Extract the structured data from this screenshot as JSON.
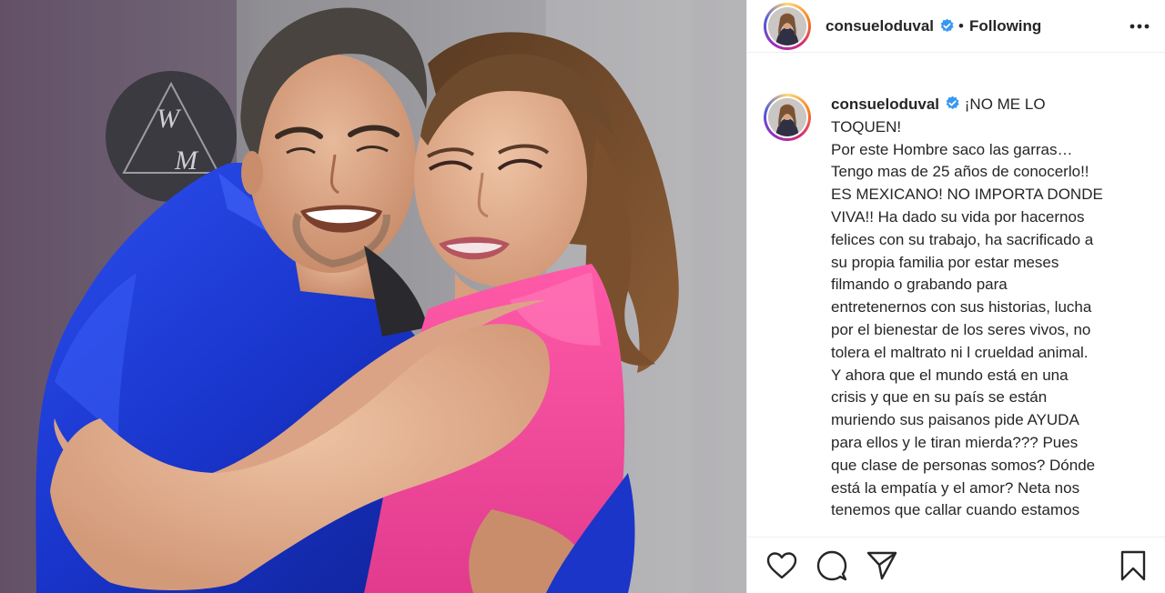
{
  "post": {
    "account": {
      "username": "consueloduval",
      "verified": true,
      "follow_status": "Following",
      "separator": "•"
    },
    "caption": {
      "username": "consueloduval",
      "lines": [
        "¡NO ME LO",
        "TOQUEN!",
        "Por este Hombre saco las garras…",
        "Tengo mas de 25 años de conocerlo!!",
        "ES MEXICANO! NO IMPORTA DONDE",
        "VIVA!! Ha dado su vida por hacernos",
        "felices con su trabajo, ha sacrificado a",
        "su propia familia por estar meses",
        "filmando o grabando para",
        "entretenernos con sus historias, lucha",
        "por el bienestar de los seres vivos, no",
        "tolera el maltrato ni l crueldad animal.",
        "Y ahora que el mundo está en una",
        "crisis y que en su país se están",
        "muriendo sus paisanos pide AYUDA",
        "para ellos y le tiran mierda??? Pues",
        "que clase de personas somos? Dónde",
        "está la empatía y el amor? Neta nos",
        "tenemos que callar cuando estamos"
      ]
    },
    "photo_sign_letters": [
      "W",
      "M"
    ],
    "actions": {
      "like_icon": "heart-icon",
      "comment_icon": "comment-icon",
      "share_icon": "paper-plane-icon",
      "save_icon": "bookmark-icon",
      "more_icon": "more-horizontal-icon"
    }
  },
  "colors": {
    "verified_badge": "#3897f0",
    "jacket": "#1c3cd8",
    "dress": "#f0449a",
    "wall": "#8d8e92",
    "text": "#262626",
    "divider": "#efefef"
  }
}
